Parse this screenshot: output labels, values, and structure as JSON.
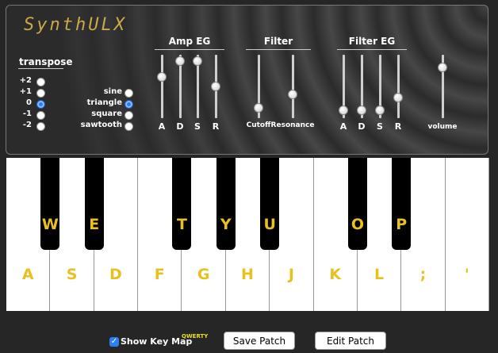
{
  "app": {
    "title": "SynthULX"
  },
  "transpose": {
    "label": "transpose",
    "options": [
      "+2",
      "+1",
      "0",
      "-1",
      "-2"
    ],
    "selected": "0"
  },
  "waveform": {
    "options": [
      "sine",
      "triangle",
      "square",
      "sawtooth"
    ],
    "selected": "triangle"
  },
  "amp_eg": {
    "title": "Amp EG",
    "sliders": [
      {
        "label": "A",
        "value": 0.68
      },
      {
        "label": "D",
        "value": 0.97
      },
      {
        "label": "S",
        "value": 0.97
      },
      {
        "label": "R",
        "value": 0.5
      }
    ]
  },
  "filter": {
    "title": "Filter",
    "sliders": [
      {
        "label": "Cutoff",
        "value": 0.1
      },
      {
        "label": "Resonance",
        "value": 0.36
      }
    ]
  },
  "filter_eg": {
    "title": "Filter EG",
    "sliders": [
      {
        "label": "A",
        "value": 0.06
      },
      {
        "label": "D",
        "value": 0.06
      },
      {
        "label": "S",
        "value": 0.06
      },
      {
        "label": "R",
        "value": 0.3
      }
    ]
  },
  "volume": {
    "label": "volume",
    "value": 0.86
  },
  "keyboard": {
    "white_keys": [
      "A",
      "S",
      "D",
      "F",
      "G",
      "H",
      "J",
      "K",
      "L",
      ";",
      "'"
    ],
    "black_keys": [
      {
        "label": "W",
        "after": 0
      },
      {
        "label": "E",
        "after": 1
      },
      {
        "label": "T",
        "after": 3
      },
      {
        "label": "Y",
        "after": 4
      },
      {
        "label": "U",
        "after": 5
      },
      {
        "label": "O",
        "after": 7
      },
      {
        "label": "P",
        "after": 8
      }
    ]
  },
  "footer": {
    "show_key_map_label": "Show Key Map",
    "show_key_map_checked": true,
    "layout_badge": "QWERTY",
    "save_label": "Save Patch",
    "edit_label": "Edit Patch"
  },
  "colors": {
    "accent": "#2d7ff0",
    "key_label": "#e8c020",
    "logo": "#c9a94a"
  }
}
